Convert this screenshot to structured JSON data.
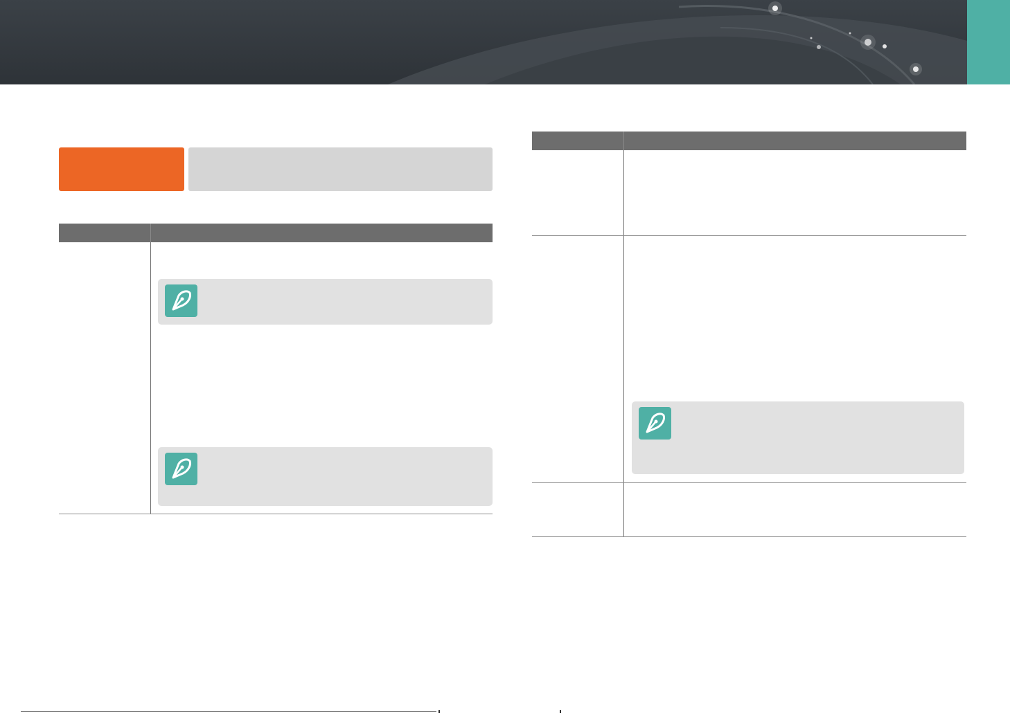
{
  "header": {
    "accent_color": "#4fb0a5",
    "background_color": "#2e3338"
  },
  "section": {
    "label_color": "#ec6625",
    "title_bar_color": "#d5d5d5"
  },
  "tables": {
    "header_color": "#6d6d6d"
  },
  "notes": {
    "icon": "pen-nib-icon",
    "box_color": "#e1e1e1"
  }
}
